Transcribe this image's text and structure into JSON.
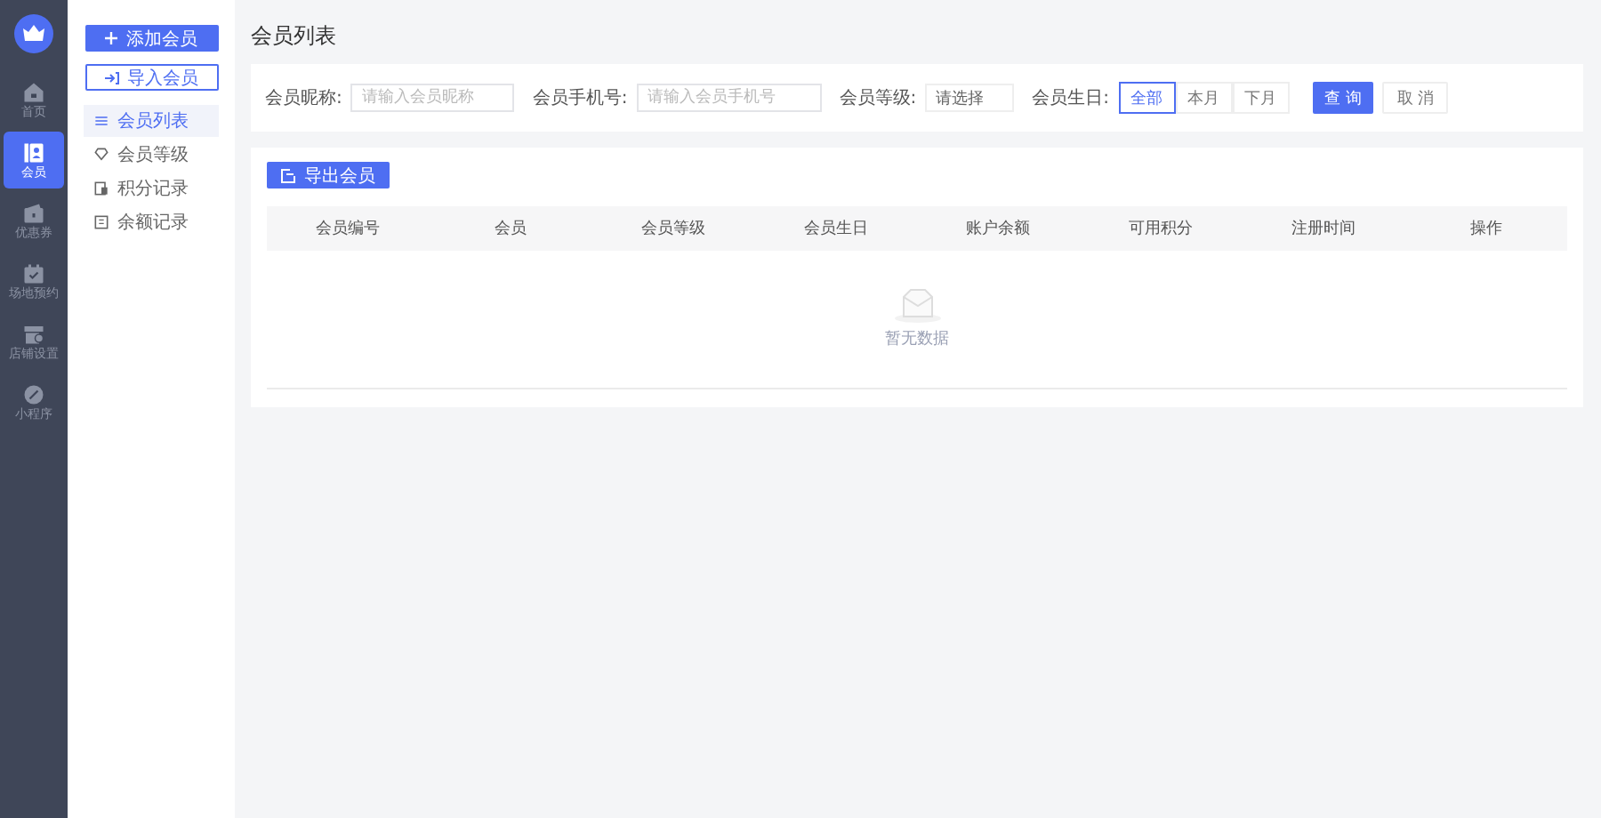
{
  "nav": [
    {
      "label": "首页",
      "selected": false
    },
    {
      "label": "会员",
      "selected": true
    },
    {
      "label": "优惠券",
      "selected": false
    },
    {
      "label": "场地预约",
      "selected": false
    },
    {
      "label": "店铺设置",
      "selected": false
    },
    {
      "label": "小程序",
      "selected": false
    }
  ],
  "sidebar": {
    "add_button": "添加会员",
    "import_button": "导入会员",
    "items": [
      {
        "label": "会员列表",
        "selected": true
      },
      {
        "label": "会员等级",
        "selected": false
      },
      {
        "label": "积分记录",
        "selected": false
      },
      {
        "label": "余额记录",
        "selected": false
      }
    ]
  },
  "page_title": "会员列表",
  "filters": {
    "nickname_label": "会员昵称:",
    "nickname_placeholder": "请输入会员昵称",
    "phone_label": "会员手机号:",
    "phone_placeholder": "请输入会员手机号",
    "level_label": "会员等级:",
    "level_placeholder": "请选择",
    "birthday_label": "会员生日:",
    "birthday_options": [
      {
        "label": "全部",
        "selected": true
      },
      {
        "label": "本月",
        "selected": false
      },
      {
        "label": "下月",
        "selected": false
      }
    ],
    "search_button": "查 询",
    "cancel_button": "取 消"
  },
  "export_button": "导出会员",
  "table": {
    "columns": [
      "会员编号",
      "会员",
      "会员等级",
      "会员生日",
      "账户余额",
      "可用积分",
      "注册时间",
      "操作"
    ],
    "empty_text": "暂无数据"
  }
}
